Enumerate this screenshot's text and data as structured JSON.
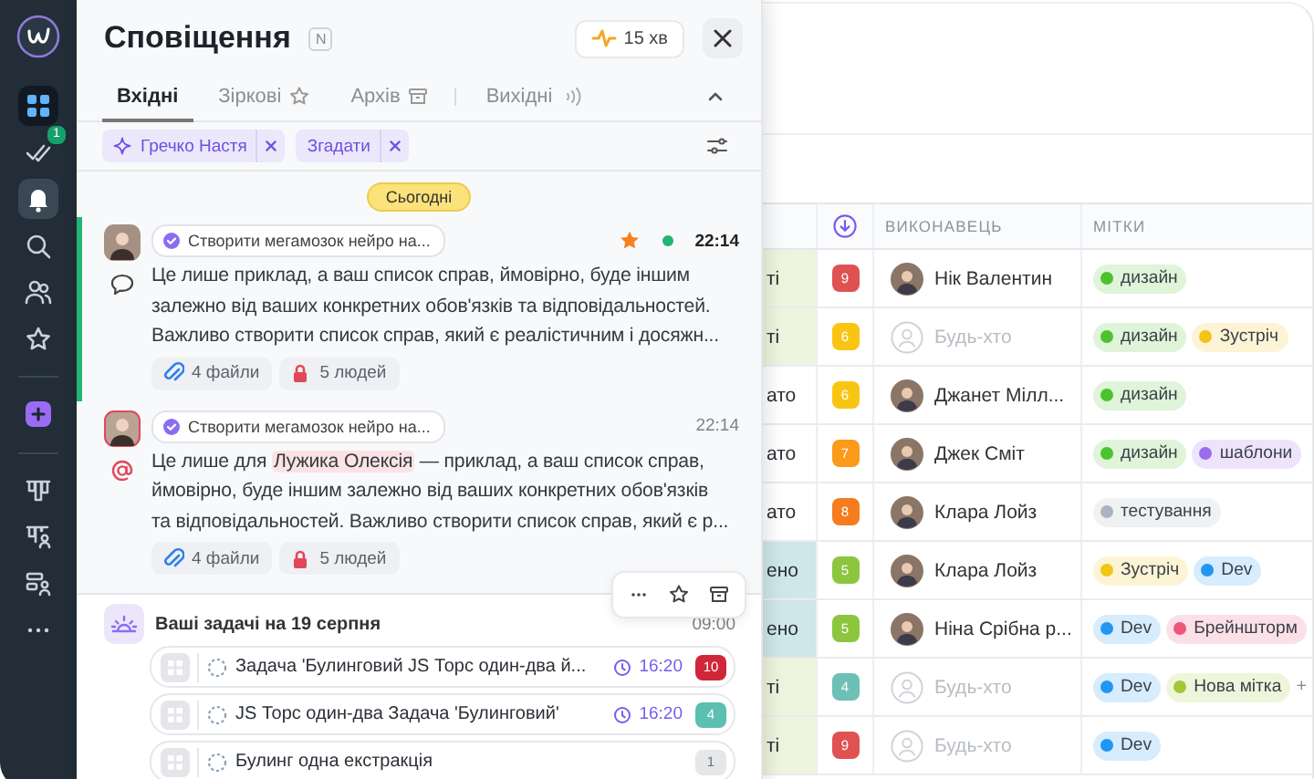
{
  "sidebar": {
    "groups": [
      [
        {
          "kind": "apps",
          "selected": false
        },
        {
          "kind": "tasks",
          "badge": "1",
          "selected": false
        },
        {
          "kind": "bell",
          "selected": true
        },
        {
          "kind": "search",
          "selected": false
        },
        {
          "kind": "people",
          "selected": false
        },
        {
          "kind": "star",
          "selected": false
        }
      ],
      [
        {
          "kind": "plus",
          "selected": false
        }
      ],
      [
        {
          "kind": "board",
          "selected": false
        },
        {
          "kind": "board-person",
          "selected": false
        },
        {
          "kind": "list-person",
          "selected": false
        },
        {
          "kind": "more",
          "selected": false
        }
      ]
    ]
  },
  "panel": {
    "title": "Сповіщення",
    "shortcut": "N",
    "timer": "15 хв",
    "tabs": [
      {
        "label": "Вхідні",
        "kind": "inbox",
        "separated": false,
        "selected": true
      },
      {
        "label": "Зіркові",
        "kind": "starred",
        "separated": false,
        "selected": false
      },
      {
        "label": "Архів",
        "kind": "archive",
        "separated": false,
        "selected": false
      },
      {
        "label": "Вихідні",
        "kind": "outbox",
        "separated": true,
        "selected": false
      }
    ],
    "filters": [
      {
        "label": "Гречко Настя",
        "kind": "person"
      },
      {
        "label": "Згадати",
        "kind": "mention"
      }
    ],
    "day": "Сьогодні",
    "notifications": [
      {
        "kind": "comment",
        "unread": true,
        "starred": true,
        "task": "Створити мегамозок нейро на...",
        "time": "22:14",
        "text": [
          {
            "kind": "plain",
            "text": "Це лише приклад, а ваш список справ, ймовірно, буде іншим\nзалежно від ваших конкретних обов'язків та відповідальностей.\nВажливо створити список справ, який є реалістичним і досяжн..."
          }
        ],
        "chips": [
          {
            "kind": "files",
            "label": "4 файли"
          },
          {
            "kind": "people",
            "label": "5 людей"
          }
        ]
      },
      {
        "kind": "mention",
        "unread": false,
        "starred": false,
        "task": "Створити мегамозок нейро на...",
        "time": "22:14",
        "text": [
          {
            "kind": "plain",
            "text": "Це лише для "
          },
          {
            "kind": "mention",
            "text": "Лужика Олексія"
          },
          {
            "kind": "plain",
            "text": " — приклад, а ваш список справ,\nймовірно, буде іншим залежно від ваших конкретних обов'язків\nта відповідальностей. Важливо створити список справ, який є р..."
          }
        ],
        "chips": [
          {
            "kind": "files",
            "label": "4 файли"
          },
          {
            "kind": "people",
            "label": "5 людей"
          }
        ],
        "hover_actions": [
          {
            "kind": "more"
          },
          {
            "kind": "star"
          },
          {
            "kind": "archive"
          }
        ]
      }
    ],
    "digest": {
      "title": "Ваші задачі на 19 серпня",
      "time": "09:00",
      "tasks": [
        {
          "title": "Задача 'Булинговий JS Торс один-два й...",
          "time": "16:20",
          "count": "10",
          "color": "#d0263a"
        },
        {
          "title": "JS Торс один-два Задача 'Булинговий'",
          "time": "16:20",
          "count": "4",
          "color": "#5bbfb1"
        },
        {
          "title": "Булинг одна екстракція",
          "count": "1",
          "color": "#e6e7e9"
        }
      ]
    }
  },
  "table": {
    "columns": [
      {
        "kind": "status"
      },
      {
        "kind": "priority"
      },
      {
        "kind": "text",
        "label": "ВИКОНАВЕЦЬ"
      },
      {
        "kind": "text",
        "label": "МІТКИ"
      }
    ],
    "rows": [
      {
        "status": {
          "label": "ті",
          "color": "#eef4dd"
        },
        "priority": {
          "label": "9",
          "color": "#e05252"
        },
        "assignee": "Нік Валентин",
        "assigned": true,
        "tags": [
          {
            "label": "дизайн",
            "color": "#4cc22e"
          }
        ]
      },
      {
        "status": {
          "label": "ті",
          "color": "#eef4dd"
        },
        "priority": {
          "label": "6",
          "color": "#f9c513"
        },
        "assignee": "Будь-хто",
        "assigned": false,
        "tags": [
          {
            "label": "дизайн",
            "color": "#4cc22e"
          },
          {
            "label": "Зустріч",
            "color": "#f2c416"
          }
        ]
      },
      {
        "status": {
          "label": "ато",
          "color": "#ffffff"
        },
        "priority": {
          "label": "6",
          "color": "#f9c513"
        },
        "assignee": "Джанет Мілл...",
        "assigned": true,
        "tags": [
          {
            "label": "дизайн",
            "color": "#4cc22e"
          }
        ]
      },
      {
        "status": {
          "label": "ато",
          "color": "#ffffff"
        },
        "priority": {
          "label": "7",
          "color": "#fb9a1b"
        },
        "assignee": "Джек Сміт",
        "assigned": true,
        "tags": [
          {
            "label": "дизайн",
            "color": "#4cc22e"
          },
          {
            "label": "шаблони",
            "color": "#9b6cf0"
          }
        ]
      },
      {
        "status": {
          "label": "ато",
          "color": "#ffffff"
        },
        "priority": {
          "label": "8",
          "color": "#f57c1f"
        },
        "assignee": "Клара Лойз",
        "assigned": true,
        "tags": [
          {
            "label": "тестування",
            "color": "#aab4bf"
          }
        ]
      },
      {
        "status": {
          "label": "ено",
          "color": "#cfe7e9"
        },
        "priority": {
          "label": "5",
          "color": "#8cc63f"
        },
        "assignee": "Клара Лойз",
        "assigned": true,
        "tags": [
          {
            "label": "Зустріч",
            "color": "#f2c416"
          },
          {
            "label": "Dev",
            "color": "#2196f3"
          }
        ]
      },
      {
        "status": {
          "label": "ено",
          "color": "#cfe7e9"
        },
        "priority": {
          "label": "5",
          "color": "#8cc63f"
        },
        "assignee": "Ніна Срібна р...",
        "assigned": true,
        "tags": [
          {
            "label": "Dev",
            "color": "#2196f3"
          },
          {
            "label": "Брейншторм",
            "color": "#f0557a"
          }
        ]
      },
      {
        "status": {
          "label": "ті",
          "color": "#eef4dd"
        },
        "priority": {
          "label": "4",
          "color": "#6cc0b5"
        },
        "assignee": "Будь-хто",
        "assigned": false,
        "tags": [
          {
            "label": "Dev",
            "color": "#2196f3"
          },
          {
            "label": "Нова мітка",
            "color": "#a4c639"
          }
        ],
        "more": "+"
      },
      {
        "status": {
          "label": "ті",
          "color": "#eef4dd"
        },
        "priority": {
          "label": "9",
          "color": "#e05252"
        },
        "assignee": "Будь-хто",
        "assigned": false,
        "tags": [
          {
            "label": "Dev",
            "color": "#2196f3"
          }
        ]
      }
    ]
  }
}
